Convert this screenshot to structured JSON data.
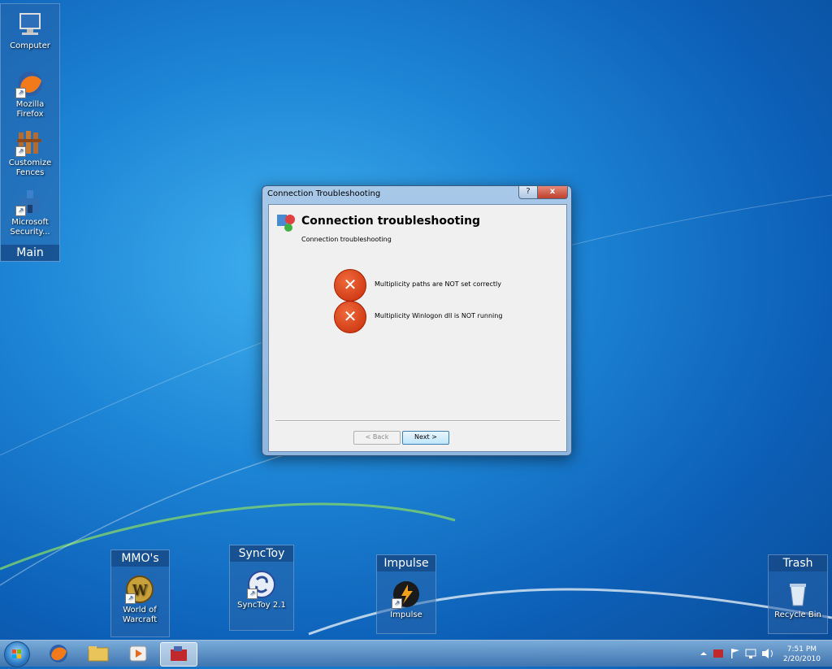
{
  "desktop": {
    "main_fence": {
      "title": "Main",
      "icons": [
        {
          "name": "computer",
          "label": "Computer",
          "icon": "computer-icon"
        },
        {
          "name": "firefox",
          "label": "Mozilla Firefox",
          "icon": "firefox-icon"
        },
        {
          "name": "fences",
          "label": "Customize Fences",
          "icon": "fences-icon"
        },
        {
          "name": "security",
          "label": "Microsoft Security...",
          "icon": "security-essentials-icon"
        }
      ]
    },
    "mmo_fence": {
      "title": "MMO's",
      "icon_label": "World of Warcraft"
    },
    "synctoy_fence": {
      "title": "SyncToy",
      "icon_label": "SyncToy 2.1"
    },
    "impulse_fence": {
      "title": "Impulse",
      "icon_label": "Impulse"
    },
    "trash_fence": {
      "title": "Trash",
      "icon_label": "Recycle Bin"
    }
  },
  "dialog": {
    "window_title": "Connection Troubleshooting",
    "help_label": "?",
    "close_label": "x",
    "heading": "Connection troubleshooting",
    "subheading": "Connection troubleshooting",
    "errors": [
      {
        "text": "Multiplicity paths are NOT set correctly",
        "icon": "error-icon"
      },
      {
        "text": "Multiplicity Winlogon dll is NOT running",
        "icon": "error-icon"
      }
    ],
    "back_label": "< Back",
    "next_label": "Next >"
  },
  "taskbar": {
    "clock_time": "7:51 PM",
    "clock_date": "2/20/2010"
  },
  "colors": {
    "error_red": "#d2380e",
    "accent_blue": "#1e86d6"
  }
}
